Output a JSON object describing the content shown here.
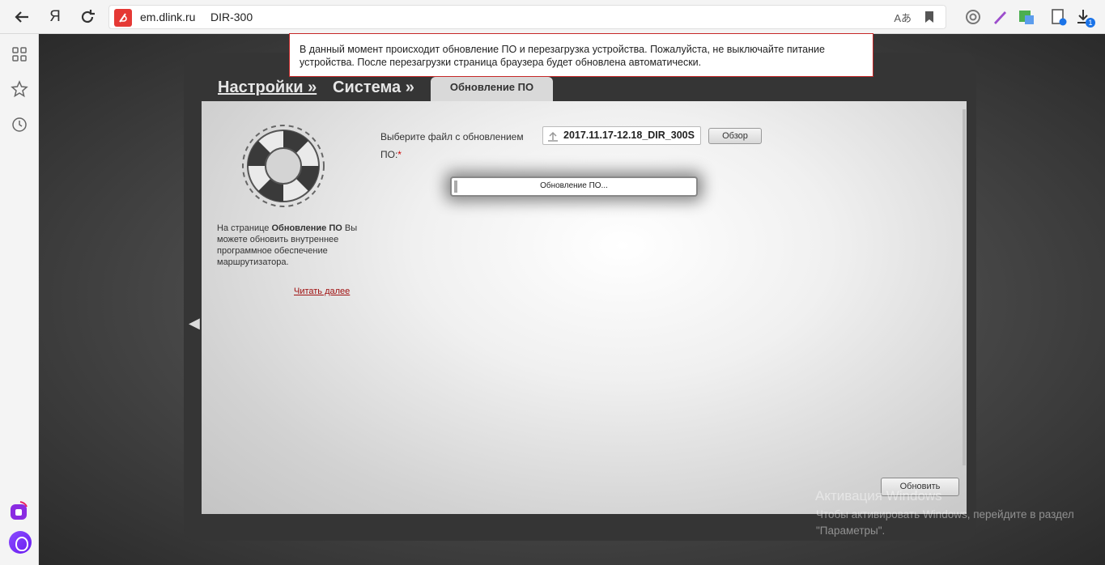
{
  "browser": {
    "address_host": "em.dlink.ru",
    "address_title": "DIR-300",
    "translate_glyph": "Aあ",
    "download_badge": "1",
    "yandex_glyph": "Я"
  },
  "router": {
    "breadcrumb": {
      "settings": "Настройки »",
      "system": "Система »"
    },
    "active_tab": "Обновление ПО",
    "description_prefix": "На странице ",
    "description_bold": "Обновление ПО",
    "description_suffix": " Вы можете обновить внутреннее программное обеспечение маршрутизатора.",
    "read_more": "Читать далее",
    "file_label": "Выберите файл с обновлением ПО:",
    "required_mark": "*",
    "file_value": "2017.11.17-12.18_DIR_300S",
    "browse_button": "Обзор",
    "progress_text": "Обновление ПО...",
    "update_button": "Обновить"
  },
  "notice": {
    "text": "В данный момент происходит обновление ПО и перезагрузка устройства. Пожалуйста, не выключайте питание устройства. После перезагрузки страница браузера будет обновлена автоматически."
  },
  "watermark": {
    "title": "Активация Windows",
    "text": "Чтобы активировать Windows, перейдите в раздел \"Параметры\"."
  },
  "colors": {
    "accent_red": "#e53935",
    "notice_border": "#c62828",
    "alice_purple": "#7a2cff"
  }
}
